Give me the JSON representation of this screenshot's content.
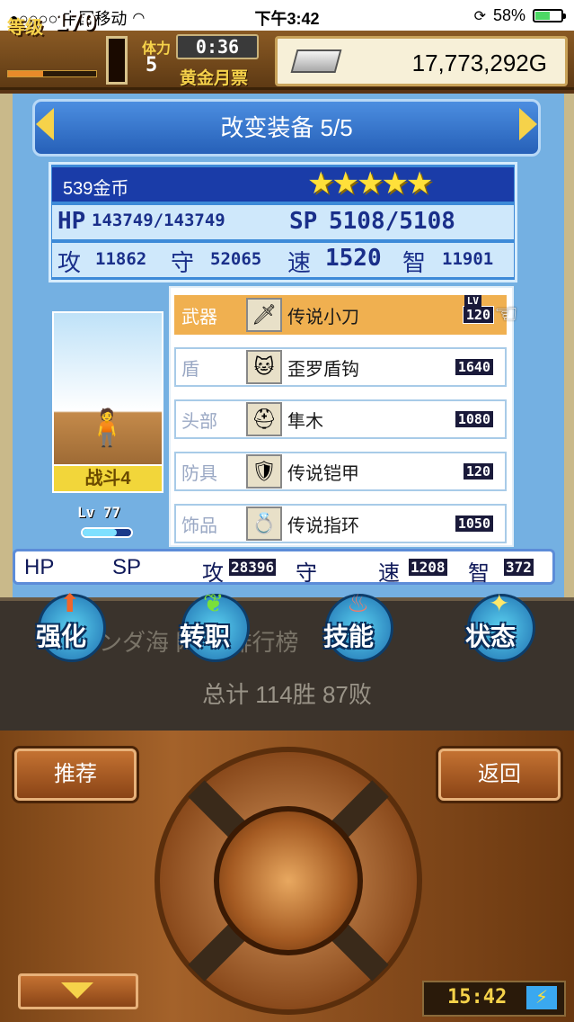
{
  "status_bar": {
    "carrier": "●○○○○ 中国移动",
    "time": "下午3:42",
    "battery_percent": "58%",
    "battery_level": 0.58
  },
  "hud": {
    "level_label": "等级",
    "level_value": "170",
    "ticket_label": "体力",
    "ticket_count": "5",
    "timer": "0:36",
    "gold_ticket_label": "黄金月票",
    "gold": "17,773,292G"
  },
  "screen": {
    "title": "改变装备 5/5",
    "coins": "539金币",
    "stars": "★★★★★",
    "hp_label": "HP",
    "hp_value": "143749/143749",
    "sp_label": "SP",
    "sp_value": "5108/5108",
    "atk_label": "攻",
    "atk_value": "11862",
    "def_label": "守",
    "def_value": "52065",
    "spd_label": "速",
    "spd_value": "1520",
    "int_label": "智",
    "int_value": "11901"
  },
  "character": {
    "battle_label": "战斗4",
    "lv_text": "Lv 77"
  },
  "equipment": [
    {
      "slot": "武器",
      "name": "传说小刀",
      "value": "120",
      "icon": "sword-icon",
      "lv_tag": "LV"
    },
    {
      "slot": "盾",
      "name": "歪罗盾钩",
      "value": "1640",
      "icon": "cat-shield-icon"
    },
    {
      "slot": "头部",
      "name": "隼木",
      "value": "1080",
      "icon": "helmet-icon"
    },
    {
      "slot": "防具",
      "name": "传说铠甲",
      "value": "120",
      "icon": "armor-icon"
    },
    {
      "slot": "饰品",
      "name": "传说指环",
      "value": "1050",
      "icon": "ring-icon"
    }
  ],
  "bottom_stats": {
    "hp": "HP",
    "sp": "SP",
    "atk_label": "攻",
    "atk_value": "28396",
    "def_label": "守",
    "spd_label": "速",
    "spd_value": "1208",
    "int_label": "智",
    "int_value": "372"
  },
  "actions": [
    {
      "label": "强化",
      "icon": "upgrade-arrow-icon"
    },
    {
      "label": "转职",
      "icon": "leaf-icon"
    },
    {
      "label": "技能",
      "icon": "flame-icon"
    },
    {
      "label": "状态",
      "icon": "sparkle-icon"
    }
  ],
  "info": {
    "ranking_text": "ンダ海   网络  排行榜",
    "total": "总计 114胜 87败"
  },
  "controls": {
    "recommend": "推荐",
    "back": "返回",
    "clock": "15:42"
  }
}
